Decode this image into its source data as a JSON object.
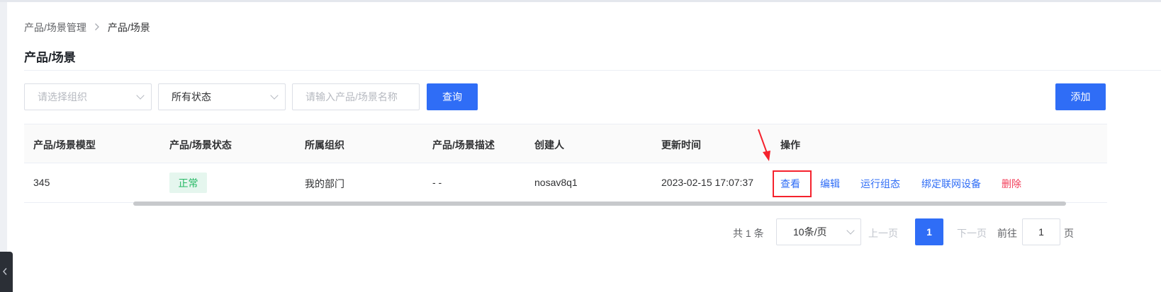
{
  "breadcrumb": {
    "parent": "产品/场景管理",
    "separator": ">",
    "current": "产品/场景"
  },
  "page_title": "产品/场景",
  "filters": {
    "org_placeholder": "请选择组织",
    "status_value": "所有状态",
    "name_placeholder": "请输入产品/场景名称",
    "query_label": "查询",
    "add_label": "添加"
  },
  "table": {
    "columns": [
      "产品/场景模型",
      "产品/场景状态",
      "所属组织",
      "产品/场景描述",
      "创建人",
      "更新时间",
      "操作"
    ],
    "rows": [
      {
        "model": "345",
        "status": "正常",
        "org": "我的部门",
        "description": "- -",
        "creator": "nosav8q1",
        "updated": "2023-02-15 17:07:37",
        "actions": [
          "查看",
          "编辑",
          "运行组态",
          "绑定联网设备",
          "删除"
        ]
      }
    ]
  },
  "pagination": {
    "total": "共 1 条",
    "page_size": "10条/页",
    "prev": "上一页",
    "current": "1",
    "next": "下一页",
    "goto_label": "前往",
    "goto_value": "1",
    "goto_unit": "页"
  },
  "colors": {
    "primary": "#2f6df6",
    "success": "#25b864",
    "danger": "#f23d59",
    "highlight": "#f5222d"
  },
  "icons": {
    "breadcrumb_separator": "chevron-right-icon",
    "select_arrow": "chevron-down-icon",
    "annotation": "red-arrow-icon"
  }
}
